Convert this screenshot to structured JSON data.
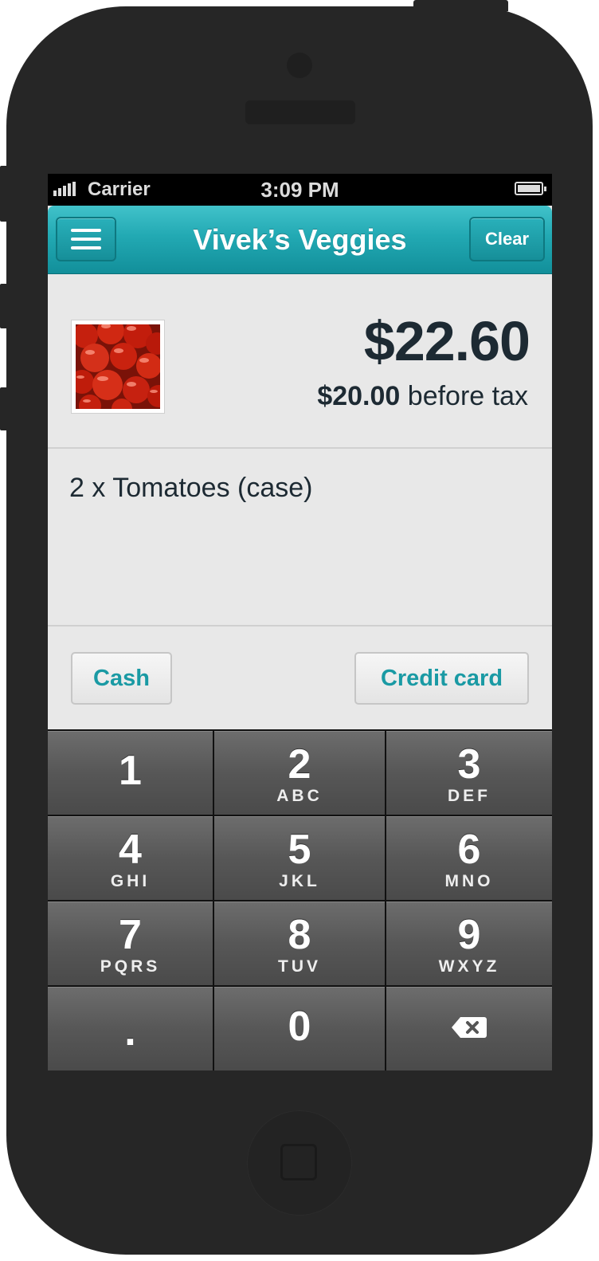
{
  "status_bar": {
    "carrier": "Carrier",
    "time": "3:09 PM"
  },
  "nav": {
    "title": "Vivek’s Veggies",
    "clear_label": "Clear",
    "menu_icon": "hamburger-menu-icon"
  },
  "summary": {
    "total": "$22.60",
    "subtotal_amount": "$20.00",
    "subtotal_suffix": "before tax",
    "product_image": "tomatoes"
  },
  "order": {
    "line_items": [
      "2 x Tomatoes (case)"
    ]
  },
  "payment": {
    "cash_label": "Cash",
    "card_label": "Credit card"
  },
  "keypad": {
    "keys": [
      {
        "digit": "1",
        "letters": ""
      },
      {
        "digit": "2",
        "letters": "ABC"
      },
      {
        "digit": "3",
        "letters": "DEF"
      },
      {
        "digit": "4",
        "letters": "GHI"
      },
      {
        "digit": "5",
        "letters": "JKL"
      },
      {
        "digit": "6",
        "letters": "MNO"
      },
      {
        "digit": "7",
        "letters": "PQRS"
      },
      {
        "digit": "8",
        "letters": "TUV"
      },
      {
        "digit": "9",
        "letters": "WXYZ"
      },
      {
        "digit": ".",
        "letters": ""
      },
      {
        "digit": "0",
        "letters": ""
      },
      {
        "digit": "",
        "letters": "",
        "icon": "backspace-icon"
      }
    ]
  },
  "colors": {
    "accent": "#1a9aa4",
    "nav_bar": "#22a9b3",
    "text_dark": "#1d2a33",
    "phone_body": "#262626"
  }
}
